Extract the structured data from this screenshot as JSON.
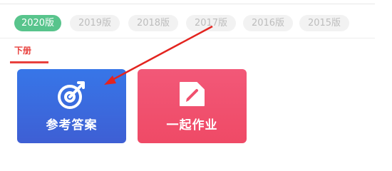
{
  "year_tabs": [
    {
      "label": "2020版",
      "active": true
    },
    {
      "label": "2019版",
      "active": false
    },
    {
      "label": "2018版",
      "active": false
    },
    {
      "label": "2017版",
      "active": false
    },
    {
      "label": "2016版",
      "active": false
    },
    {
      "label": "2015版",
      "active": false
    }
  ],
  "volume_tab": {
    "label": "下册"
  },
  "cards": {
    "answers": {
      "label": "参考答案",
      "icon": "target-icon"
    },
    "homework": {
      "label": "一起作业",
      "icon": "pencil-note-icon"
    }
  },
  "colors": {
    "active_year": "#58c48c",
    "accent_red": "#e8413e",
    "answers_card": "#3a6ae0",
    "homework_card": "#f0506e"
  }
}
